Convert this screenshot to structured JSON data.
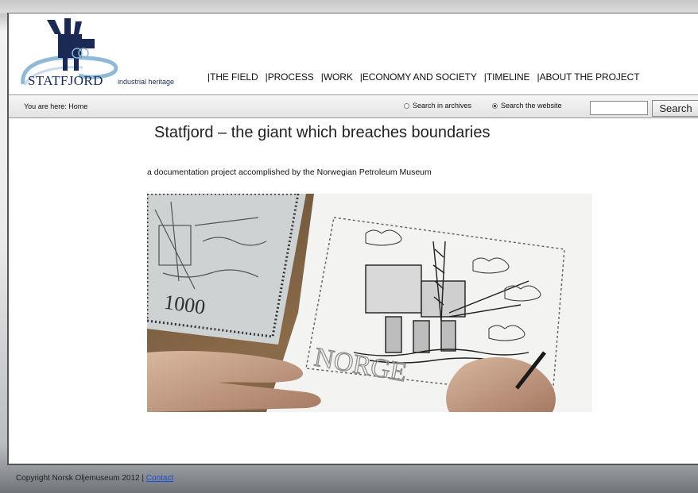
{
  "header": {
    "logo_name": "STATFJORD",
    "logo_subtitle": "industrial heritage"
  },
  "nav": [
    {
      "label": "THE FIELD"
    },
    {
      "label": "PROCESS"
    },
    {
      "label": "WORK"
    },
    {
      "label": "ECONOMY AND SOCIETY"
    },
    {
      "label": "TIMELINE"
    },
    {
      "label": "ABOUT THE PROJECT"
    }
  ],
  "breadcrumb": "You are here: Home",
  "search": {
    "archives_label": "Search in archives",
    "website_label": "Search the website",
    "selected": "website",
    "input_value": "",
    "button_label": "Search"
  },
  "main": {
    "title": "Statfjord – the giant which breaches boundaries",
    "subtitle": "a documentation project accomplished by the Norwegian Petroleum Museum"
  },
  "hero": {
    "stamp_value": "1000",
    "stamp_country": "NORGE"
  },
  "footer": {
    "copyright": "Copyright Norsk Oljemuseum 2012 |",
    "contact_label": "Contact"
  },
  "colors": {
    "brand_navy": "#1b2a55",
    "logo_blue": "#2a6fa8",
    "link": "#1a4fd8"
  }
}
